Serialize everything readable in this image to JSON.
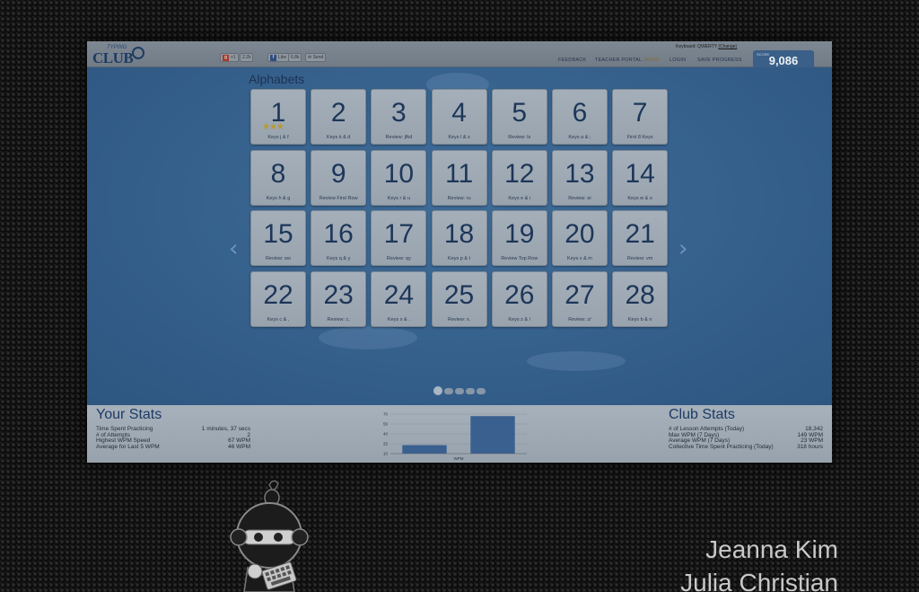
{
  "topbar": {
    "logo_top": "TYPING",
    "logo_main": "CLUB",
    "gplus_label": "+1",
    "gplus_count": "2.2k",
    "fb_like": "Like",
    "fb_count": "6.8k",
    "send_label": "Send",
    "keyboard_info": "Keyboard: QWERTY",
    "change_link": "(Change)",
    "nav": [
      "FEEDBACK",
      "TEACHER PORTAL",
      "LOGIN",
      "SAVE PROGRESS"
    ],
    "new_badge": "(NEW)",
    "score_label": "SCORE",
    "score_value": "9,086"
  },
  "main": {
    "section_title": "Alphabets",
    "prev_arrow": "‹",
    "next_arrow": "›",
    "page_count": 5,
    "active_page": 1,
    "lessons": [
      {
        "num": "1",
        "label": "Keys j & f",
        "stars": "★★★"
      },
      {
        "num": "2",
        "label": "Keys k & d"
      },
      {
        "num": "3",
        "label": "Review: jfkd"
      },
      {
        "num": "4",
        "label": "Keys l & s"
      },
      {
        "num": "5",
        "label": "Review: ls"
      },
      {
        "num": "6",
        "label": "Keys a & ;"
      },
      {
        "num": "7",
        "label": "First 8 Keys"
      },
      {
        "num": "8",
        "label": "Keys h & g"
      },
      {
        "num": "9",
        "label": "Review First Row"
      },
      {
        "num": "10",
        "label": "Keys r & u"
      },
      {
        "num": "11",
        "label": "Review: ru"
      },
      {
        "num": "12",
        "label": "Keys e & i"
      },
      {
        "num": "13",
        "label": "Review: ei"
      },
      {
        "num": "14",
        "label": "Keys w & o"
      },
      {
        "num": "15",
        "label": "Review: wo"
      },
      {
        "num": "16",
        "label": "Keys q & y"
      },
      {
        "num": "17",
        "label": "Review: qy"
      },
      {
        "num": "18",
        "label": "Keys p & t"
      },
      {
        "num": "19",
        "label": "Review Top Row"
      },
      {
        "num": "20",
        "label": "Keys v & m"
      },
      {
        "num": "21",
        "label": "Review: vm"
      },
      {
        "num": "22",
        "label": "Keys c & ,"
      },
      {
        "num": "23",
        "label": "Review: c,"
      },
      {
        "num": "24",
        "label": "Keys x & ."
      },
      {
        "num": "25",
        "label": "Review: x."
      },
      {
        "num": "26",
        "label": "Keys z & /"
      },
      {
        "num": "27",
        "label": "Review: z/"
      },
      {
        "num": "28",
        "label": "Keys b & n"
      }
    ]
  },
  "your_stats": {
    "title": "Your Stats",
    "rows": [
      {
        "label": "Time Spent Practicing",
        "value": "1 minutes, 37 secs"
      },
      {
        "label": "# of Attempts",
        "value": "2"
      },
      {
        "label": "Highest WPM Speed",
        "value": "67 WPM"
      },
      {
        "label": "Average for Last 5 WPM",
        "value": "46 WPM"
      }
    ]
  },
  "club_stats": {
    "title": "Club Stats",
    "rows": [
      {
        "label": "# of Lesson Attempts (Today)",
        "value": "18,342"
      },
      {
        "label": "Max WPM (7 Days)",
        "value": "149 WPM"
      },
      {
        "label": "Average WPM (7 Days)",
        "value": "23 WPM"
      },
      {
        "label": "Collective Time Spent Practicing (Today)",
        "value": "318 hours"
      }
    ]
  },
  "chart_data": {
    "type": "bar",
    "categories": [
      "1",
      "2"
    ],
    "values": [
      23,
      67
    ],
    "xlabel": "WPM",
    "ylim": [
      10,
      70
    ],
    "yticks": [
      10,
      25,
      40,
      55,
      70
    ],
    "bar_color": "#3a6090"
  },
  "credits": [
    "Jeanna Kim",
    "Julia Christian"
  ],
  "colors": {
    "background": "#0d0d0d",
    "board_blue": "#35608c",
    "tile_gray": "#a4afba",
    "accent_navy": "#1d3658"
  }
}
